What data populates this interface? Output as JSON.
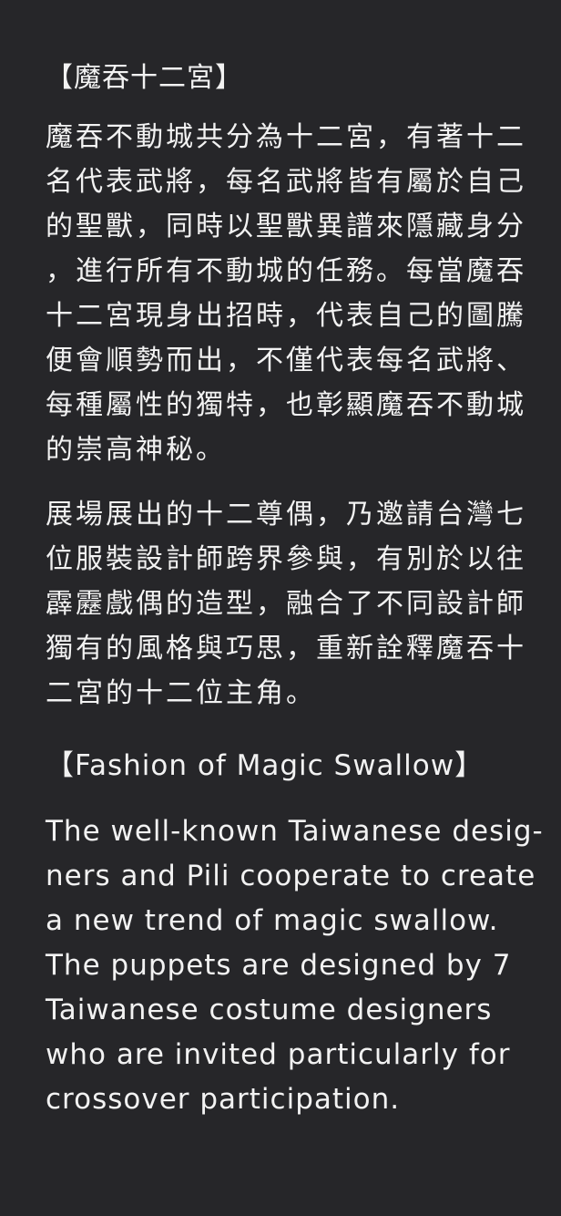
{
  "zh_section": {
    "heading": "【魔吞十二宮】",
    "paragraph1_lines": [
      "魔吞不動城共分為十二宮，有著十二",
      "名代表武將，每名武將皆有屬於自己",
      "的聖獸，同時以聖獸異譜來隱藏身分",
      "，進行所有不動城的任務。每當魔吞",
      "十二宮現身出招時，代表自己的圖騰",
      "便會順勢而出，不僅代表每名武將、",
      "每種屬性的獨特，也彰顯魔吞不動城",
      "的崇高神秘。"
    ],
    "paragraph2_lines": [
      "展場展出的十二尊偶，乃邀請台灣七",
      "位服裝設計師跨界參與，有別於以往",
      "霹靂戲偶的造型，融合了不同設計師",
      "獨有的風格與巧思，重新詮釋魔吞十",
      "二宮的十二位主角。"
    ]
  },
  "en_section": {
    "heading": "【Fashion of Magic Swallow】",
    "paragraph_lines": [
      "The well-known Taiwanese desig-",
      "ners and Pili cooperate to create",
      "a new trend of magic swallow.",
      "The puppets are designed by 7",
      "Taiwanese costume designers",
      "who are invited particularly for",
      "crossover participation."
    ]
  }
}
